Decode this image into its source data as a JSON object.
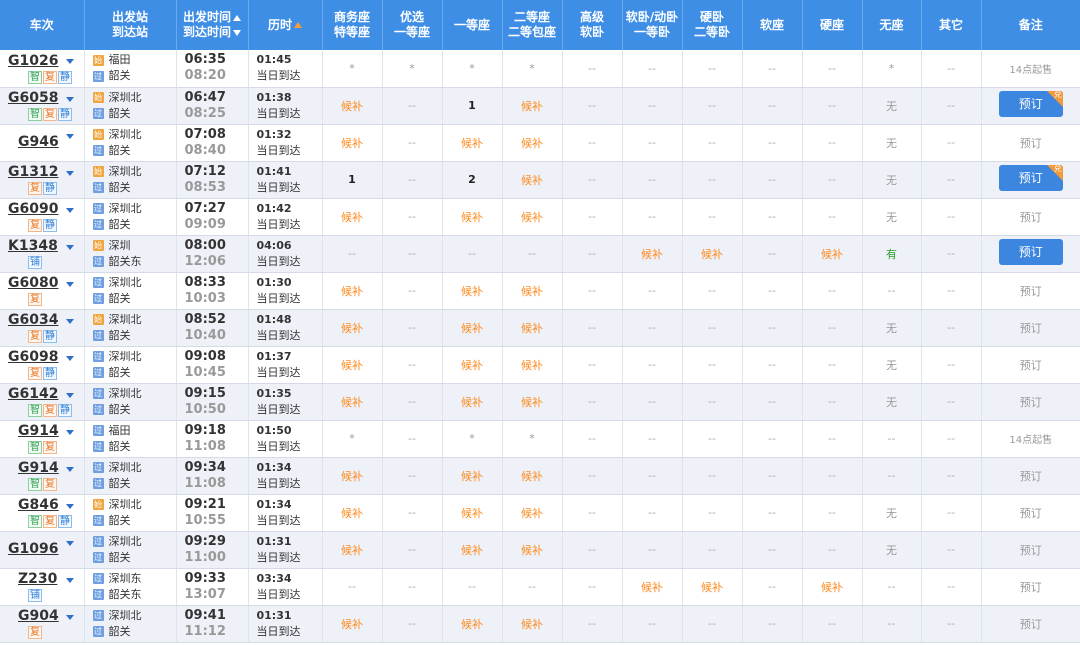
{
  "columns": [
    {
      "l1": "车次",
      "l2": ""
    },
    {
      "l1": "出发站",
      "l2": "到达站"
    },
    {
      "l1": "出发时间",
      "l2": "到达时间"
    },
    {
      "l1": "历时",
      "l2": ""
    },
    {
      "l1": "商务座",
      "l2": "特等座"
    },
    {
      "l1": "优选",
      "l2": "一等座"
    },
    {
      "l1": "一等座",
      "l2": ""
    },
    {
      "l1": "二等座",
      "l2": "二等包座"
    },
    {
      "l1": "高级",
      "l2": "软卧"
    },
    {
      "l1": "软卧/动卧",
      "l2": "一等卧"
    },
    {
      "l1": "硬卧",
      "l2": "二等卧"
    },
    {
      "l1": "软座",
      "l2": ""
    },
    {
      "l1": "硬座",
      "l2": ""
    },
    {
      "l1": "无座",
      "l2": ""
    },
    {
      "l1": "其它",
      "l2": ""
    },
    {
      "l1": "备注",
      "l2": ""
    }
  ],
  "icons": {
    "start": "始",
    "pass": "过"
  },
  "trains": [
    {
      "no": "G1026",
      "badges": [
        "智",
        "复",
        "静"
      ],
      "from": "福田",
      "from_type": "start",
      "to": "韶关",
      "dep": "06:35",
      "arr": "08:20",
      "dur": "01:45",
      "day": "当日到达",
      "seats": [
        "*",
        "*",
        "*",
        "*",
        "--",
        "--",
        "--",
        "--",
        "--",
        "*",
        "--"
      ],
      "note": {
        "type": "text",
        "text": "14点起售"
      }
    },
    {
      "no": "G6058",
      "badges": [
        "智",
        "复",
        "静"
      ],
      "from": "深圳北",
      "from_type": "start",
      "to": "韶关",
      "dep": "06:47",
      "arr": "08:25",
      "dur": "01:38",
      "day": "当日到达",
      "seats": [
        "候补",
        "--",
        "1",
        "候补",
        "--",
        "--",
        "--",
        "--",
        "--",
        "无",
        "--"
      ],
      "note": {
        "type": "button",
        "text": "预订",
        "corner": "兑"
      }
    },
    {
      "no": "G946",
      "badges": [],
      "from": "深圳北",
      "from_type": "start",
      "to": "韶关",
      "dep": "07:08",
      "arr": "08:40",
      "dur": "01:32",
      "day": "当日到达",
      "seats": [
        "候补",
        "--",
        "候补",
        "候补",
        "--",
        "--",
        "--",
        "--",
        "--",
        "无",
        "--"
      ],
      "note": {
        "type": "text",
        "text": "预订"
      }
    },
    {
      "no": "G1312",
      "badges": [
        "复",
        "静"
      ],
      "from": "深圳北",
      "from_type": "start",
      "to": "韶关",
      "dep": "07:12",
      "arr": "08:53",
      "dur": "01:41",
      "day": "当日到达",
      "seats": [
        "1",
        "--",
        "2",
        "候补",
        "--",
        "--",
        "--",
        "--",
        "--",
        "无",
        "--"
      ],
      "note": {
        "type": "button",
        "text": "预订",
        "corner": "兑"
      }
    },
    {
      "no": "G6090",
      "badges": [
        "复",
        "静"
      ],
      "from": "深圳北",
      "from_type": "pass",
      "to": "韶关",
      "dep": "07:27",
      "arr": "09:09",
      "dur": "01:42",
      "day": "当日到达",
      "seats": [
        "候补",
        "--",
        "候补",
        "候补",
        "--",
        "--",
        "--",
        "--",
        "--",
        "无",
        "--"
      ],
      "note": {
        "type": "text",
        "text": "预订"
      }
    },
    {
      "no": "K1348",
      "badges": [
        "铺"
      ],
      "from": "深圳",
      "from_type": "start",
      "to": "韶关东",
      "dep": "08:00",
      "arr": "12:06",
      "dur": "04:06",
      "day": "当日到达",
      "seats": [
        "--",
        "--",
        "--",
        "--",
        "--",
        "候补",
        "候补",
        "--",
        "候补",
        "有",
        "--"
      ],
      "note": {
        "type": "button",
        "text": "预订",
        "corner": ""
      }
    },
    {
      "no": "G6080",
      "badges": [
        "复"
      ],
      "from": "深圳北",
      "from_type": "pass",
      "to": "韶关",
      "dep": "08:33",
      "arr": "10:03",
      "dur": "01:30",
      "day": "当日到达",
      "seats": [
        "候补",
        "--",
        "候补",
        "候补",
        "--",
        "--",
        "--",
        "--",
        "--",
        "--",
        "--"
      ],
      "note": {
        "type": "text",
        "text": "预订"
      }
    },
    {
      "no": "G6034",
      "badges": [
        "复",
        "静"
      ],
      "from": "深圳北",
      "from_type": "start",
      "to": "韶关",
      "dep": "08:52",
      "arr": "10:40",
      "dur": "01:48",
      "day": "当日到达",
      "seats": [
        "候补",
        "--",
        "候补",
        "候补",
        "--",
        "--",
        "--",
        "--",
        "--",
        "无",
        "--"
      ],
      "note": {
        "type": "text",
        "text": "预订"
      }
    },
    {
      "no": "G6098",
      "badges": [
        "复",
        "静"
      ],
      "from": "深圳北",
      "from_type": "pass",
      "to": "韶关",
      "dep": "09:08",
      "arr": "10:45",
      "dur": "01:37",
      "day": "当日到达",
      "seats": [
        "候补",
        "--",
        "候补",
        "候补",
        "--",
        "--",
        "--",
        "--",
        "--",
        "无",
        "--"
      ],
      "note": {
        "type": "text",
        "text": "预订"
      }
    },
    {
      "no": "G6142",
      "badges": [
        "智",
        "复",
        "静"
      ],
      "from": "深圳北",
      "from_type": "pass",
      "to": "韶关",
      "dep": "09:15",
      "arr": "10:50",
      "dur": "01:35",
      "day": "当日到达",
      "seats": [
        "候补",
        "--",
        "候补",
        "候补",
        "--",
        "--",
        "--",
        "--",
        "--",
        "无",
        "--"
      ],
      "note": {
        "type": "text",
        "text": "预订"
      }
    },
    {
      "no": "G914",
      "badges": [
        "智",
        "复"
      ],
      "from": "福田",
      "from_type": "pass",
      "to": "韶关",
      "dep": "09:18",
      "arr": "11:08",
      "dur": "01:50",
      "day": "当日到达",
      "seats": [
        "*",
        "--",
        "*",
        "*",
        "--",
        "--",
        "--",
        "--",
        "--",
        "--",
        "--"
      ],
      "note": {
        "type": "text",
        "text": "14点起售"
      }
    },
    {
      "no": "G914",
      "badges": [
        "智",
        "复"
      ],
      "from": "深圳北",
      "from_type": "pass",
      "to": "韶关",
      "dep": "09:34",
      "arr": "11:08",
      "dur": "01:34",
      "day": "当日到达",
      "seats": [
        "候补",
        "--",
        "候补",
        "候补",
        "--",
        "--",
        "--",
        "--",
        "--",
        "--",
        "--"
      ],
      "note": {
        "type": "text",
        "text": "预订"
      }
    },
    {
      "no": "G846",
      "badges": [
        "智",
        "复",
        "静"
      ],
      "from": "深圳北",
      "from_type": "start",
      "to": "韶关",
      "dep": "09:21",
      "arr": "10:55",
      "dur": "01:34",
      "day": "当日到达",
      "seats": [
        "候补",
        "--",
        "候补",
        "候补",
        "--",
        "--",
        "--",
        "--",
        "--",
        "无",
        "--"
      ],
      "note": {
        "type": "text",
        "text": "预订"
      }
    },
    {
      "no": "G1096",
      "badges": [],
      "from": "深圳北",
      "from_type": "pass",
      "to": "韶关",
      "dep": "09:29",
      "arr": "11:00",
      "dur": "01:31",
      "day": "当日到达",
      "seats": [
        "候补",
        "--",
        "候补",
        "候补",
        "--",
        "--",
        "--",
        "--",
        "--",
        "无",
        "--"
      ],
      "note": {
        "type": "text",
        "text": "预订"
      }
    },
    {
      "no": "Z230",
      "badges": [
        "铺"
      ],
      "from": "深圳东",
      "from_type": "pass",
      "to": "韶关东",
      "dep": "09:33",
      "arr": "13:07",
      "dur": "03:34",
      "day": "当日到达",
      "seats": [
        "--",
        "--",
        "--",
        "--",
        "--",
        "候补",
        "候补",
        "--",
        "候补",
        "--",
        "--"
      ],
      "note": {
        "type": "text",
        "text": "预订"
      }
    },
    {
      "no": "G904",
      "badges": [
        "复"
      ],
      "from": "深圳北",
      "from_type": "pass",
      "to": "韶关",
      "dep": "09:41",
      "arr": "11:12",
      "dur": "01:31",
      "day": "当日到达",
      "seats": [
        "候补",
        "--",
        "候补",
        "候补",
        "--",
        "--",
        "--",
        "--",
        "--",
        "--",
        "--"
      ],
      "note": {
        "type": "text",
        "text": "预订"
      }
    }
  ]
}
